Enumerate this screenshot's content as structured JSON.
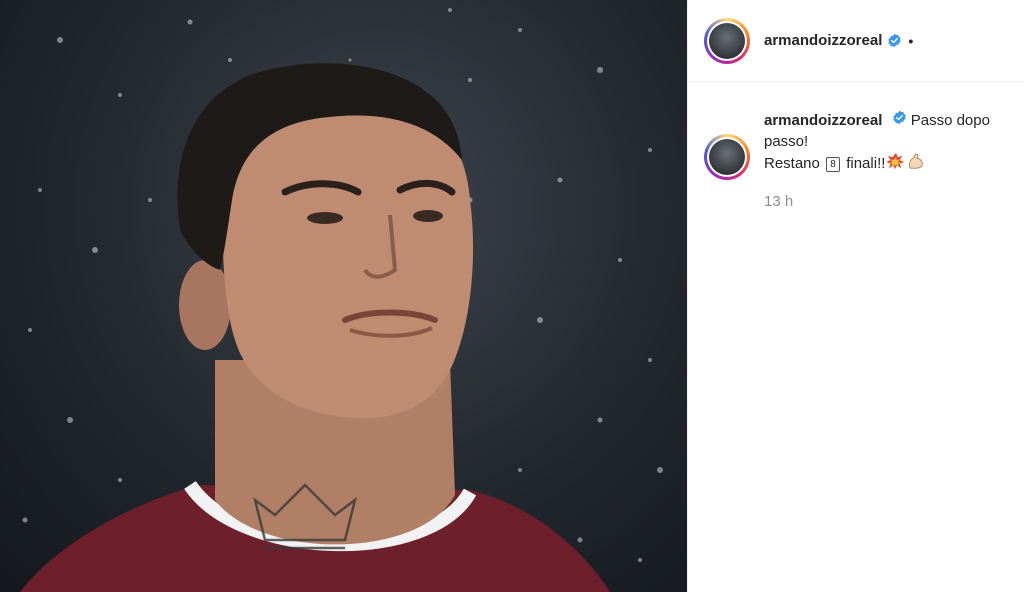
{
  "post": {
    "username": "armandoizzoreal",
    "separator": "•",
    "caption": {
      "username": "armandoizzoreal",
      "line1": "Passo dopo",
      "line2": "passo!",
      "line3_prefix": "Restano",
      "keycap_number": "8",
      "line3_suffix": "finali!!",
      "emojis": [
        "collision-icon",
        "flexed-biceps-icon"
      ]
    },
    "timestamp": "13 h"
  },
  "colors": {
    "verified_blue": "#3897f0",
    "jersey": "#6d1f2b",
    "story_ring": [
      "#feda75",
      "#fa7e1e",
      "#d62976",
      "#962fbf"
    ]
  }
}
